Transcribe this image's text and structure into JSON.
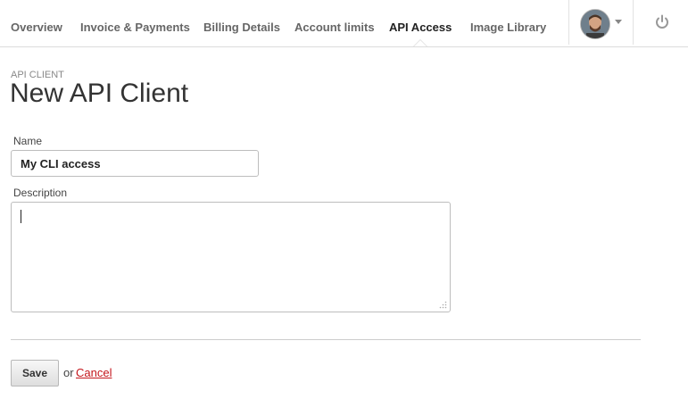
{
  "nav": {
    "tabs": [
      {
        "label": "Overview"
      },
      {
        "label": "Invoice & Payments"
      },
      {
        "label": "Billing Details"
      },
      {
        "label": "Account limits"
      },
      {
        "label": "API Access",
        "active": true
      },
      {
        "label": "Image Library"
      }
    ]
  },
  "header": {
    "eyebrow": "API CLIENT",
    "title": "New API Client"
  },
  "form": {
    "name_label": "Name",
    "name_value": "My CLI access",
    "description_label": "Description",
    "description_value": ""
  },
  "actions": {
    "save_label": "Save",
    "or_text": "or",
    "cancel_label": "Cancel"
  },
  "colors": {
    "cancel_link": "#c4161c",
    "active_tab": "#222222"
  },
  "icons": [
    "avatar",
    "chevron-down-icon",
    "power-icon",
    "resize-grip-icon"
  ]
}
